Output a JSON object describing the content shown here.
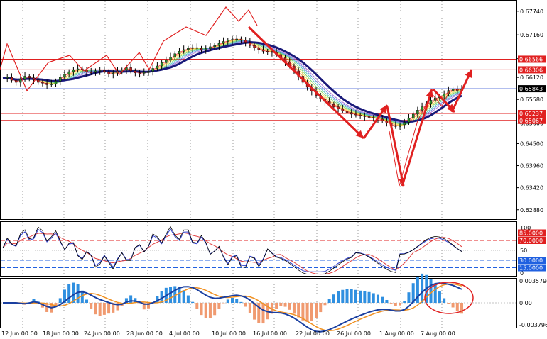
{
  "chart_data": {
    "type": "candlestick",
    "price_axis": {
      "ticks": [
        "0.67740",
        "0.67160",
        "0.66580",
        "0.66120",
        "0.65580",
        "0.65000",
        "0.64500",
        "0.63960",
        "0.63420",
        "0.62880"
      ],
      "ylim": [
        0.6265,
        0.6798
      ]
    },
    "price_badges": [
      {
        "label": "0.66566",
        "value": 0.66566,
        "color": "#e02020"
      },
      {
        "label": "0.66306",
        "value": 0.66306,
        "color": "#e02020"
      },
      {
        "label": "0.65843",
        "value": 0.65843,
        "color": "#000000"
      },
      {
        "label": "0.65237",
        "value": 0.65237,
        "color": "#e02020"
      },
      {
        "label": "0.65067",
        "value": 0.65067,
        "color": "#e02020"
      }
    ],
    "stoch_axis": {
      "ticks": [
        "100",
        "50",
        "0"
      ],
      "levels": [
        {
          "label": "85.0000",
          "value": 85,
          "color": "#e02020"
        },
        {
          "label": "70.0000",
          "value": 70,
          "color": "#e02020"
        },
        {
          "label": "30.0000",
          "value": 30,
          "color": "#2060e0"
        },
        {
          "label": "15.0000",
          "value": 15,
          "color": "#2060e0"
        }
      ]
    },
    "macd_axis": {
      "ticks": [
        "0.0035796",
        "0.00",
        "-0.003796"
      ]
    },
    "x_labels": [
      "12 Jun 00:00",
      "18 Jun 00:00",
      "24 Jun 00:00",
      "28 Jun 00:00",
      "4 Jul 00:00",
      "10 Jul 00:00",
      "16 Jul 00:00",
      "22 Jul 00:00",
      "26 Jul 00:00",
      "1 Aug 00:00",
      "7 Aug 00:00"
    ],
    "close_series": [
      0.661,
      0.6612,
      0.6605,
      0.66,
      0.6608,
      0.6615,
      0.6611,
      0.6606,
      0.66,
      0.6598,
      0.6594,
      0.6596,
      0.6603,
      0.6612,
      0.662,
      0.6626,
      0.663,
      0.6633,
      0.663,
      0.6625,
      0.6624,
      0.6628,
      0.6629,
      0.6626,
      0.662,
      0.6622,
      0.6627,
      0.663,
      0.6636,
      0.6628,
      0.6623,
      0.6622,
      0.6624,
      0.6627,
      0.6634,
      0.664,
      0.6648,
      0.6655,
      0.6662,
      0.667,
      0.6676,
      0.668,
      0.6683,
      0.6685,
      0.6683,
      0.668,
      0.6682,
      0.6687,
      0.669,
      0.6695,
      0.67,
      0.6703,
      0.6705,
      0.6706,
      0.6703,
      0.6698,
      0.669,
      0.6685,
      0.668,
      0.6676,
      0.6675,
      0.6673,
      0.6668,
      0.666,
      0.665,
      0.664,
      0.6628,
      0.6615,
      0.66,
      0.6588,
      0.6578,
      0.6568,
      0.656,
      0.6553,
      0.6546,
      0.654,
      0.6535,
      0.653,
      0.6526,
      0.6522,
      0.652,
      0.6518,
      0.6516,
      0.6514,
      0.6512,
      0.651,
      0.6506,
      0.65,
      0.6494,
      0.6492,
      0.6496,
      0.6502,
      0.6512,
      0.6522,
      0.6532,
      0.654,
      0.6548,
      0.6556,
      0.6562,
      0.6566,
      0.6572,
      0.658,
      0.6584,
      0.658,
      0.6583
    ],
    "annotations": {
      "arrow_colour": "#e02020",
      "circle_colour": "#e02020"
    }
  }
}
